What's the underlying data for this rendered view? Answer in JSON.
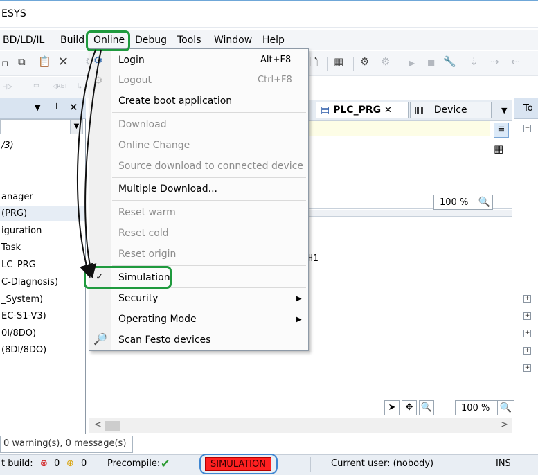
{
  "window": {
    "title_fragment": "ESYS"
  },
  "menubar": {
    "items": [
      {
        "label": "BD/LD/IL"
      },
      {
        "label": "Build"
      },
      {
        "label": "Online"
      },
      {
        "label": "Debug"
      },
      {
        "label": "Tools"
      },
      {
        "label": "Window"
      },
      {
        "label": "Help"
      }
    ]
  },
  "toolbar2": {
    "ret_label": "RET"
  },
  "left_pane": {
    "combo_value": "",
    "items": [
      {
        "label": "/3)"
      },
      {
        "label": "anager"
      },
      {
        "label": "(PRG)"
      },
      {
        "label": "iguration"
      },
      {
        "label": "Task"
      },
      {
        "label": "LC_PRG"
      },
      {
        "label": "C-Diagnosis)"
      },
      {
        "label": "_System)"
      },
      {
        "label": "EC-S1-V3)"
      },
      {
        "label": "0I/8DO)"
      },
      {
        "label": "(8DI/8DO)"
      }
    ]
  },
  "editor": {
    "tabs": [
      {
        "label": "PLC_PRG"
      },
      {
        "label": "Device"
      }
    ],
    "zoom_top": "100 %",
    "zoom_bottom": "100 %",
    "code_fragment": "H1"
  },
  "right_pane": {
    "title_fragment": "To"
  },
  "online_menu": {
    "items": [
      {
        "label": "Login",
        "shortcut": "Alt+F8",
        "enabled": true
      },
      {
        "label": "Logout",
        "shortcut": "Ctrl+F8",
        "enabled": false
      },
      {
        "label": "Create boot application",
        "enabled": true
      },
      {
        "label": "Download",
        "enabled": false
      },
      {
        "label": "Online Change",
        "enabled": false
      },
      {
        "label": "Source download to connected device",
        "enabled": false
      },
      {
        "label": "Multiple Download...",
        "enabled": true
      },
      {
        "label": "Reset warm",
        "enabled": false
      },
      {
        "label": "Reset cold",
        "enabled": false
      },
      {
        "label": "Reset origin",
        "enabled": false
      },
      {
        "label": "Simulation",
        "enabled": true,
        "checked": true
      },
      {
        "label": "Security",
        "enabled": true,
        "submenu": true
      },
      {
        "label": "Operating Mode",
        "enabled": true,
        "submenu": true
      },
      {
        "label": "Scan Festo devices",
        "enabled": true
      }
    ],
    "check_glyph": "✓"
  },
  "messages": {
    "tab_label": "0 warning(s), 0 message(s)"
  },
  "statusbar": {
    "build_label": "t build:",
    "errors": "0",
    "warnings": "0",
    "precompile_label": "Precompile:",
    "simulation_badge": "SIMULATION",
    "current_user": "Current user: (nobody)",
    "ins": "INS"
  },
  "colors": {
    "highlight_green": "#1f9a3e",
    "simulation_red": "#ff2020",
    "status_blue": "#3f86d1"
  }
}
